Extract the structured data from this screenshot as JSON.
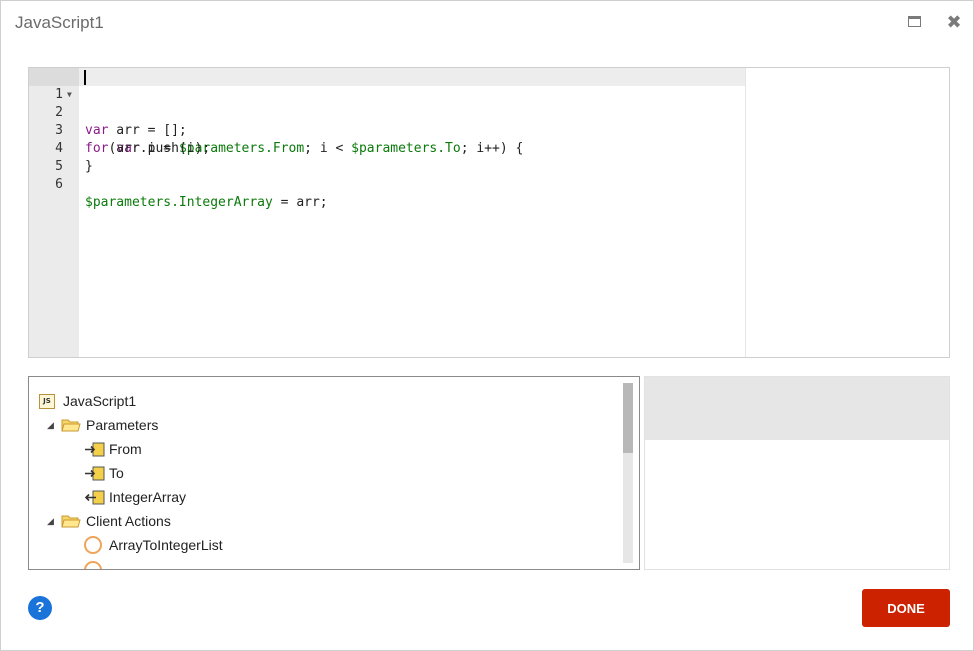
{
  "window": {
    "title": "JavaScript1"
  },
  "editor": {
    "lines": [
      {
        "number": "1"
      },
      {
        "number": "2"
      },
      {
        "number": "3"
      },
      {
        "number": "4"
      },
      {
        "number": "5"
      },
      {
        "number": "6"
      }
    ],
    "code": {
      "l1": {
        "kw": "var",
        "rest": " arr = [];"
      },
      "l2": {
        "kw1": "for",
        "p1": "(",
        "kw2": "var",
        "m1": " i = ",
        "pv1": "$parameters.From",
        "m2": "; i < ",
        "pv2": "$parameters.To",
        "m3": "; i++) {"
      },
      "l3": {
        "text": "    arr.push(i);"
      },
      "l4": {
        "text": "}"
      },
      "l5": {
        "text": ""
      },
      "l6": {
        "pv": "$parameters.IntegerArray",
        "rest": " = arr;"
      }
    }
  },
  "tree": {
    "root": "JavaScript1",
    "root_icon_text": "JS",
    "parameters": "Parameters",
    "from": "From",
    "to": "To",
    "integer_array": "IntegerArray",
    "client_actions": "Client Actions",
    "array_to_integer_list": "ArrayToIntegerList"
  },
  "footer": {
    "help": "?",
    "done": "DONE"
  },
  "colors": {
    "done": "#cc2200",
    "help": "#1a73d8",
    "keyword": "#8a1c8a",
    "param": "#0b7a0b"
  }
}
